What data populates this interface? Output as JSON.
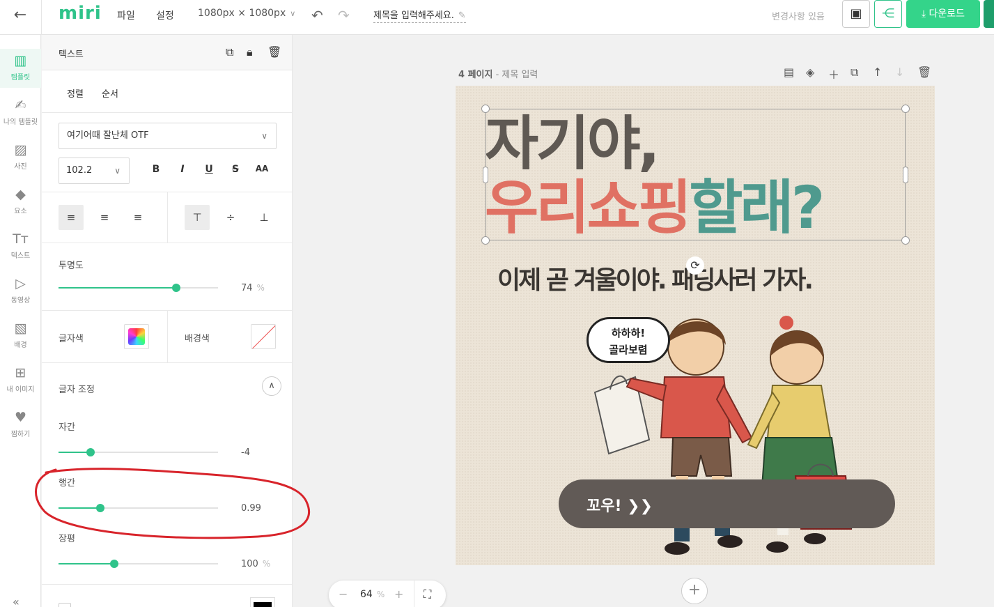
{
  "topbar": {
    "logo": "miri",
    "menu": [
      "파일",
      "설정"
    ],
    "canvas_size": "1080px × 1080px",
    "document_title": "제목을 입력해주세요.",
    "changes_status": "변경사항 있음",
    "download_label": "다운로드"
  },
  "leftnav": {
    "items": [
      {
        "label": "템플릿",
        "icon": "template-icon",
        "active": true
      },
      {
        "label": "나의 템플릿",
        "icon": "my-template-icon"
      },
      {
        "label": "사진",
        "icon": "photo-icon"
      },
      {
        "label": "요소",
        "icon": "elements-icon"
      },
      {
        "label": "텍스트",
        "icon": "text-icon"
      },
      {
        "label": "동영상",
        "icon": "video-icon"
      },
      {
        "label": "배경",
        "icon": "background-icon"
      },
      {
        "label": "내 이미지",
        "icon": "my-image-icon"
      },
      {
        "label": "찜하기",
        "icon": "heart-icon"
      }
    ]
  },
  "panel": {
    "title": "텍스트",
    "tabs": [
      "정렬",
      "순서"
    ],
    "font_family": "여기어때 잘난체 OTF",
    "font_size": "102.2",
    "style_buttons": [
      "B",
      "I",
      "U",
      "S",
      "AA"
    ],
    "opacity": {
      "label": "투명도",
      "value": "74",
      "unit": "%",
      "fraction": 0.74
    },
    "text_color_label": "글자색",
    "bg_color_label": "배경색",
    "letter_adjust_label": "글자 조정",
    "letter_spacing": {
      "label": "자간",
      "value": "-4",
      "fraction": 0.2
    },
    "line_height": {
      "label": "행간",
      "value": "0.99",
      "fraction": 0.26
    },
    "width_scale": {
      "label": "장평",
      "value": "100",
      "unit": "%",
      "fraction": 0.35
    }
  },
  "canvas": {
    "page_number": "4 페이지",
    "page_title": "- 제목 입력",
    "headline_line1": "자기야,",
    "headline_pink": "우리쇼핑",
    "headline_teal": "할래?",
    "subline": "이제 곧 겨울이야. 패딩사러 가자.",
    "bubble_line1": "하하하!",
    "bubble_line2": "골라보렴",
    "cta": "꼬우! ❯❯"
  },
  "zoom": {
    "value": "64",
    "unit": "%"
  },
  "colors": {
    "accent": "#2fc38a",
    "headline_pink": "#e07163",
    "headline_teal": "#4f9a8e"
  }
}
